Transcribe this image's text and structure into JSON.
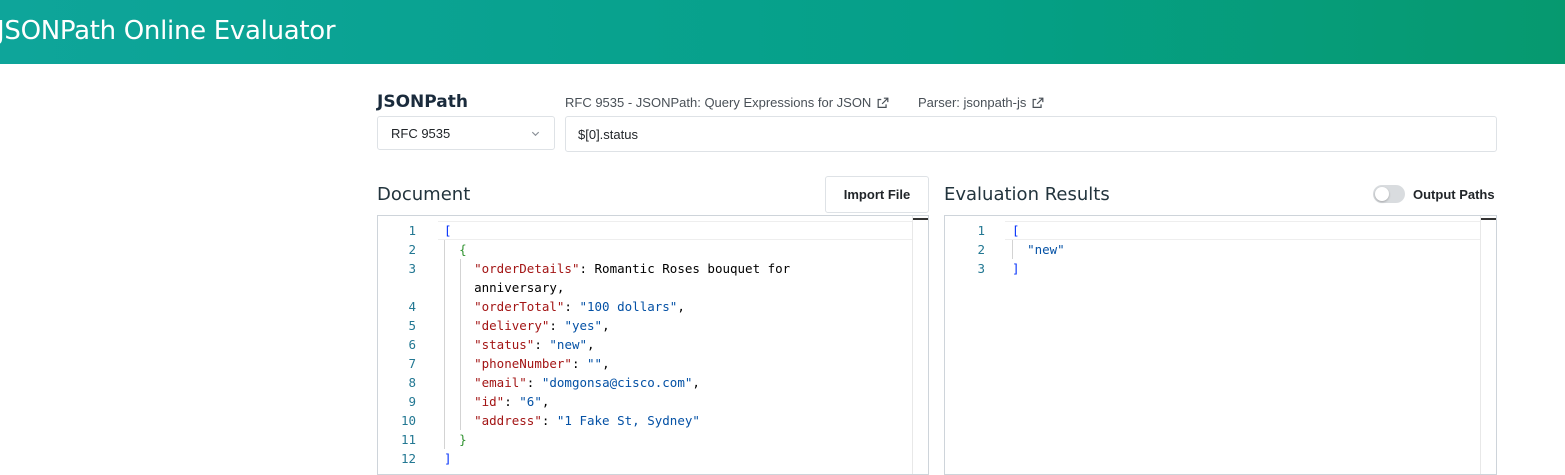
{
  "header": {
    "title": "JSONPath Online Evaluator"
  },
  "query": {
    "label": "JSONPath",
    "rfc_link": "RFC 9535 - JSONPath: Query Expressions for JSON",
    "parser_link": "Parser: jsonpath-js",
    "dialect_selected": "RFC 9535",
    "expression": "$[0].status"
  },
  "document": {
    "title": "Document",
    "import_label": "Import File",
    "lines": [
      {
        "n": "1",
        "code": "["
      },
      {
        "n": "2",
        "code": "  {"
      },
      {
        "n": "3",
        "code": "    \"orderDetails\": \"Romantic Roses bouquet for"
      },
      {
        "n": "",
        "code": "    anniversary\","
      },
      {
        "n": "4",
        "code": "    \"orderTotal\": \"100 dollars\","
      },
      {
        "n": "5",
        "code": "    \"delivery\": \"yes\","
      },
      {
        "n": "6",
        "code": "    \"status\": \"new\","
      },
      {
        "n": "7",
        "code": "    \"phoneNumber\": \"\","
      },
      {
        "n": "8",
        "code": "    \"email\": \"domgonsa@cisco.com\","
      },
      {
        "n": "9",
        "code": "    \"id\": \"6\","
      },
      {
        "n": "10",
        "code": "    \"address\": \"1 Fake St, Sydney\""
      },
      {
        "n": "11",
        "code": "  }"
      },
      {
        "n": "12",
        "code": "]"
      }
    ]
  },
  "results": {
    "title": "Evaluation Results",
    "output_paths_label": "Output Paths",
    "output_paths_enabled": false,
    "lines": [
      {
        "n": "1",
        "code": "["
      },
      {
        "n": "2",
        "code": "  \"new\""
      },
      {
        "n": "3",
        "code": "]"
      }
    ]
  },
  "colors": {
    "header_start": "#0ea59a",
    "header_end": "#06996f",
    "json_key": "#a31515",
    "json_string": "#0451a5",
    "bracket": "#0431fa",
    "brace": "#319331",
    "line_number": "#237893"
  },
  "icons": {
    "external_link": "external-link-icon",
    "select_caret": "chevron-down-icon"
  }
}
